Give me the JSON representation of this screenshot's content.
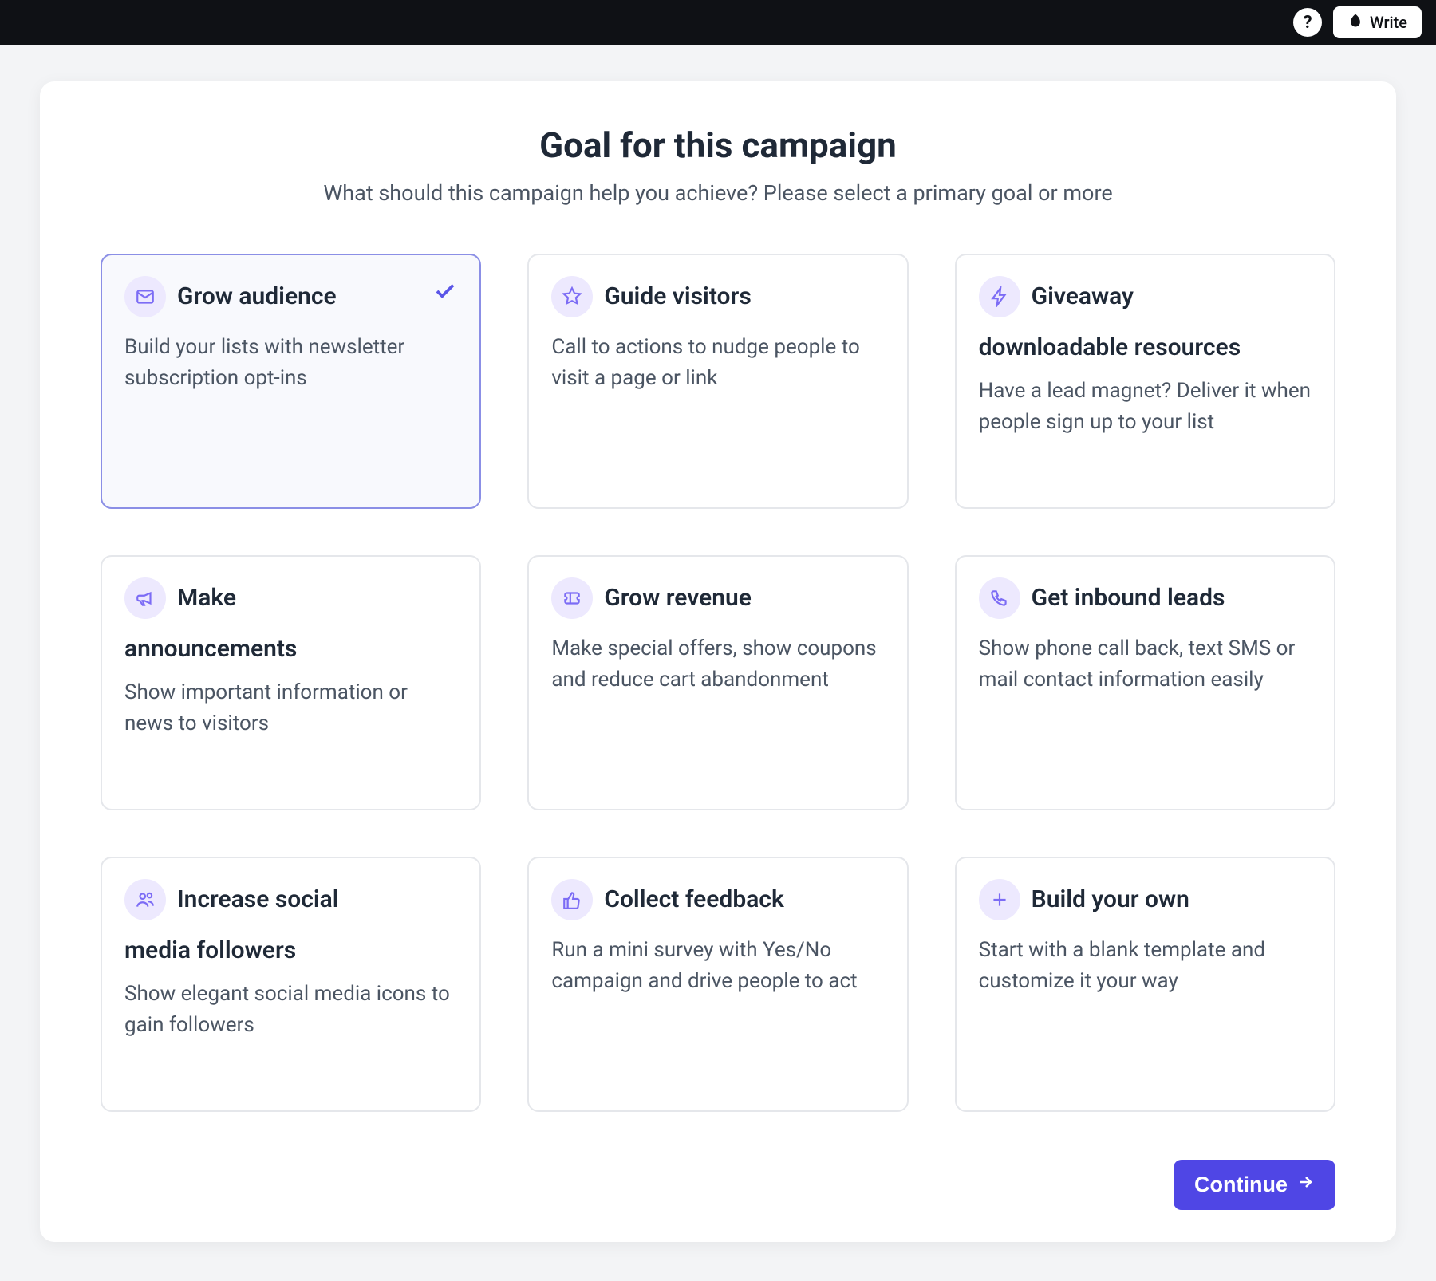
{
  "topbar": {
    "help_tooltip": "Help",
    "write_label": "Write"
  },
  "header": {
    "title": "Goal for this campaign",
    "subtitle": "What should this campaign help you achieve? Please select a primary goal or more"
  },
  "goals": [
    {
      "icon": "mail-icon",
      "title": "Grow audience",
      "subtitle": "",
      "description": "Build your lists with newsletter subscription opt-ins",
      "selected": true
    },
    {
      "icon": "star-icon",
      "title": "Guide visitors",
      "subtitle": "",
      "description": "Call to actions to nudge people to visit a page or link",
      "selected": false
    },
    {
      "icon": "bolt-icon",
      "title": "Giveaway",
      "subtitle": "downloadable resources",
      "description": "Have a lead magnet? Deliver it when people sign up to your list",
      "selected": false
    },
    {
      "icon": "megaphone-icon",
      "title": "Make",
      "subtitle": "announcements",
      "description": "Show important information or news to visitors",
      "selected": false
    },
    {
      "icon": "ticket-icon",
      "title": "Grow revenue",
      "subtitle": "",
      "description": "Make special offers, show coupons and reduce cart abandonment",
      "selected": false
    },
    {
      "icon": "phone-icon",
      "title": "Get inbound leads",
      "subtitle": "",
      "description": "Show phone call back, text SMS or mail contact information easily",
      "selected": false
    },
    {
      "icon": "users-icon",
      "title": "Increase social",
      "subtitle": "media followers",
      "description": "Show elegant social media icons to gain followers",
      "selected": false
    },
    {
      "icon": "thumbs-up-icon",
      "title": "Collect feedback",
      "subtitle": "",
      "description": "Run a mini survey with Yes/No campaign and drive people to act",
      "selected": false
    },
    {
      "icon": "plus-icon",
      "title": "Build your own",
      "subtitle": "",
      "description": "Start with a blank template and customize it your way",
      "selected": false
    }
  ],
  "footer": {
    "continue_label": "Continue"
  }
}
